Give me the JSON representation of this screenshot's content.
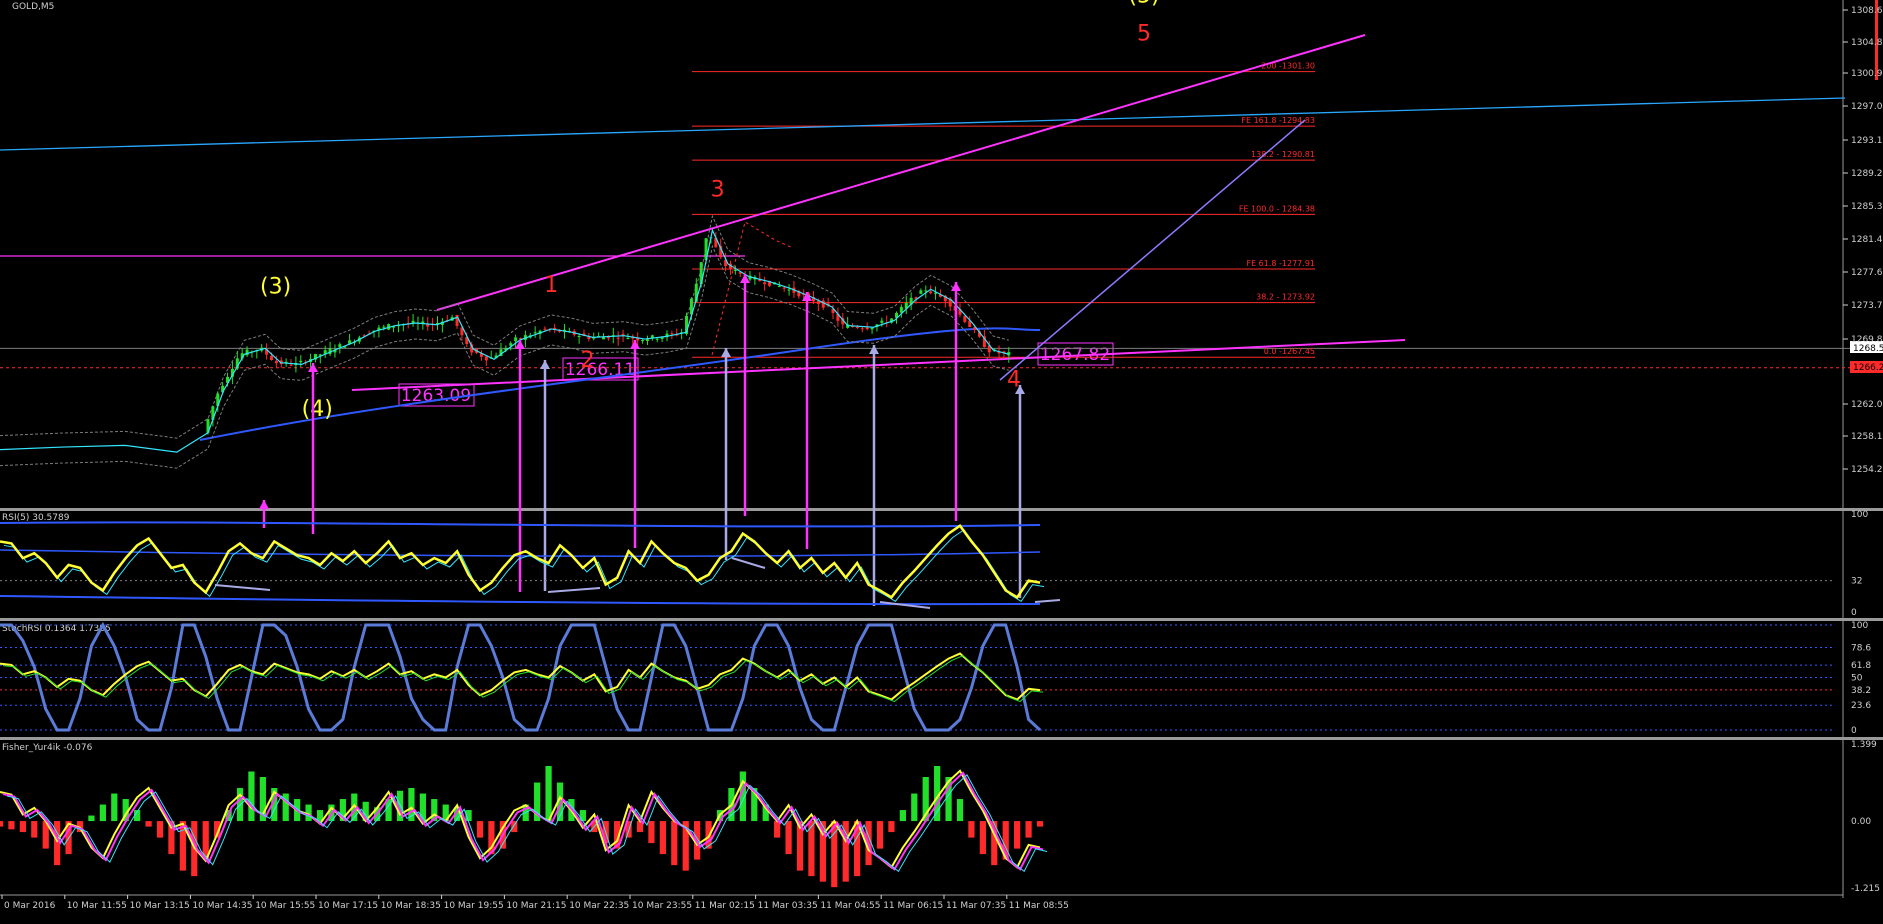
{
  "window": {
    "symbol_label": "GOLD,M5"
  },
  "colors": {
    "background": "#000000",
    "grid_text": "#cfcfcf",
    "separator": "#9a9a9a",
    "magenta": "#ff33ff",
    "red": "#ff2a2a",
    "yellow": "#ffff33",
    "blue": "#2f59ff",
    "light_blue": "#2aa8ff",
    "cyan": "#33e6ff",
    "lavender": "#a9a9e6",
    "purple": "#8c7bff",
    "green": "#22e02a",
    "gray": "#7d7d7d",
    "steel": "#5b7bd8"
  },
  "chart_data": [
    {
      "type": "candlestick",
      "name": "main",
      "ylim": [
        1254.2,
        1308.6
      ],
      "y_ticks": [
        "1308.6",
        "1304.8",
        "1300.9",
        "1297.0",
        "1293.1",
        "1289.2",
        "1285.3",
        "1281.4",
        "1277.6",
        "1273.7",
        "1269.8",
        "1262.0",
        "1258.1",
        "1254.2"
      ],
      "price_tags": [
        {
          "label": "1268.5",
          "value": 1268.5
        },
        {
          "label": "1266.2",
          "value": 1266.2
        }
      ],
      "x_ticks": [
        "0 Mar 2016",
        "10 Mar 11:55",
        "10 Mar 13:15",
        "10 Mar 14:35",
        "10 Mar 15:55",
        "10 Mar 17:15",
        "10 Mar 18:35",
        "10 Mar 19:55",
        "10 Mar 21:15",
        "10 Mar 22:35",
        "10 Mar 23:55",
        "11 Mar 02:15",
        "11 Mar 03:35",
        "11 Mar 04:55",
        "11 Mar 06:15",
        "11 Mar 07:35",
        "11 Mar 08:55"
      ],
      "close_path": [
        [
          0,
          1256.5
        ],
        [
          0.06,
          1256.8
        ],
        [
          0.12,
          1257.0
        ],
        [
          0.17,
          1256.2
        ],
        [
          0.2,
          1258.5
        ],
        [
          0.215,
          1263.5
        ],
        [
          0.235,
          1267.8
        ],
        [
          0.255,
          1268.5
        ],
        [
          0.27,
          1266.8
        ],
        [
          0.29,
          1266.6
        ],
        [
          0.32,
          1268.2
        ],
        [
          0.34,
          1269.2
        ],
        [
          0.36,
          1270.5
        ],
        [
          0.38,
          1271.2
        ],
        [
          0.4,
          1271.5
        ],
        [
          0.42,
          1271.3
        ],
        [
          0.44,
          1272.2
        ],
        [
          0.455,
          1268.4
        ],
        [
          0.475,
          1267.2
        ],
        [
          0.5,
          1269.5
        ],
        [
          0.53,
          1270.8
        ],
        [
          0.55,
          1270.4
        ],
        [
          0.57,
          1269.8
        ],
        [
          0.6,
          1270.0
        ],
        [
          0.62,
          1269.6
        ],
        [
          0.64,
          1269.9
        ],
        [
          0.66,
          1270.4
        ],
        [
          0.675,
          1276.5
        ],
        [
          0.685,
          1282.5
        ],
        [
          0.7,
          1278.5
        ],
        [
          0.72,
          1277.0
        ],
        [
          0.74,
          1276.4
        ],
        [
          0.76,
          1275.6
        ],
        [
          0.78,
          1274.6
        ],
        [
          0.8,
          1273.4
        ],
        [
          0.815,
          1271.2
        ],
        [
          0.84,
          1271.0
        ],
        [
          0.86,
          1271.8
        ],
        [
          0.88,
          1274.2
        ],
        [
          0.895,
          1275.5
        ],
        [
          0.915,
          1274.2
        ],
        [
          0.935,
          1271.5
        ],
        [
          0.955,
          1268.3
        ],
        [
          0.97,
          1267.8
        ]
      ],
      "levels": [
        {
          "label": "200 -1301.30",
          "value": 1301.3
        },
        {
          "label": "FE 161.8 -1294.83",
          "value": 1294.83
        },
        {
          "label": "138.2 - 1290.81",
          "value": 1290.81
        },
        {
          "label": "FE 100.0 - 1284.38",
          "value": 1284.38
        },
        {
          "label": "FE 61.8 -1277.91",
          "value": 1277.91
        },
        {
          "label": "38.2 - 1273.92",
          "value": 1273.92
        },
        {
          "label": "0.0 -1267.45",
          "value": 1267.45
        }
      ],
      "wave_labels": [
        {
          "text": "(5)",
          "color": "yellow",
          "x": 1.1,
          "y": 1309.5
        },
        {
          "text": "5",
          "color": "red",
          "x": 1.1,
          "y": 1305.0
        },
        {
          "text": "3",
          "color": "red",
          "x": 0.69,
          "y": 1286.5
        },
        {
          "text": "1",
          "color": "red",
          "x": 0.53,
          "y": 1275.2
        },
        {
          "text": "2",
          "color": "red",
          "x": 0.565,
          "y": 1266.3
        },
        {
          "text": "4",
          "color": "red",
          "x": 0.975,
          "y": 1264.0
        },
        {
          "text": "(3)",
          "color": "yellow",
          "x": 0.265,
          "y": 1275.0
        },
        {
          "text": "(4)",
          "color": "yellow",
          "x": 0.305,
          "y": 1260.5
        }
      ],
      "price_callouts": [
        "1263.09",
        "1266.11",
        "1267.82"
      ]
    },
    {
      "type": "line",
      "name": "rsi",
      "title": "RSI(5) 30.5789",
      "ylim": [
        0,
        100
      ],
      "y_ticks": [
        "100",
        "32",
        "0"
      ],
      "series": [
        {
          "values": [
            72,
            70,
            55,
            60,
            50,
            35,
            48,
            45,
            30,
            22,
            40,
            55,
            68,
            75,
            60,
            45,
            48,
            30,
            20,
            40,
            62,
            70,
            60,
            55,
            72,
            65,
            58,
            55,
            48,
            60,
            52,
            62,
            50,
            60,
            72,
            55,
            60,
            48,
            55,
            50,
            62,
            38,
            22,
            30,
            45,
            58,
            62,
            55,
            50,
            68,
            58,
            45,
            55,
            28,
            35,
            62,
            50,
            72,
            60,
            50,
            45,
            32,
            38,
            55,
            62,
            80,
            72,
            60,
            50,
            62,
            45,
            55,
            40,
            50,
            35,
            50,
            28,
            22,
            15,
            30,
            42,
            55,
            68,
            80,
            88,
            72,
            58,
            40,
            22,
            15,
            32,
            30
          ]
        }
      ]
    },
    {
      "type": "line",
      "name": "stochrsi",
      "title": "StochRSI 0.1364 1.7385",
      "ylim": [
        0,
        100
      ],
      "y_ticks": [
        "100",
        "78.6",
        "61.8",
        "50",
        "38.2",
        "23.6",
        "0"
      ],
      "series": [
        {
          "values": [
            100,
            100,
            85,
            60,
            20,
            0,
            0,
            30,
            80,
            100,
            80,
            50,
            10,
            0,
            0,
            40,
            100,
            100,
            70,
            30,
            0,
            0,
            50,
            100,
            100,
            90,
            60,
            20,
            0,
            0,
            10,
            60,
            100,
            100,
            100,
            70,
            30,
            10,
            0,
            0,
            60,
            100,
            100,
            80,
            50,
            10,
            0,
            0,
            30,
            80,
            100,
            100,
            100,
            60,
            20,
            0,
            0,
            50,
            100,
            100,
            80,
            40,
            0,
            0,
            0,
            30,
            80,
            100,
            100,
            80,
            40,
            10,
            0,
            0,
            40,
            80,
            100,
            100,
            100,
            60,
            20,
            0,
            0,
            0,
            10,
            40,
            80,
            100,
            100,
            60,
            10,
            0
          ]
        }
      ]
    },
    {
      "type": "bar",
      "name": "fisher",
      "title": "Fisher_Yur4ik -0.076",
      "ylim": [
        -1.215,
        1.399
      ],
      "y_ticks": [
        "1.399",
        "0.00",
        "-1.215"
      ],
      "values": [
        -0.1,
        -0.15,
        -0.2,
        -0.3,
        -0.5,
        -0.8,
        -0.6,
        -0.2,
        0.1,
        0.3,
        0.5,
        0.4,
        0.2,
        -0.1,
        -0.3,
        -0.6,
        -0.9,
        -1.0,
        -0.7,
        -0.3,
        0.2,
        0.6,
        0.9,
        0.8,
        0.6,
        0.5,
        0.4,
        0.3,
        0.2,
        0.3,
        0.4,
        0.5,
        0.35,
        0.25,
        0.4,
        0.55,
        0.6,
        0.5,
        0.4,
        0.3,
        0.25,
        0.2,
        -0.3,
        -0.6,
        -0.5,
        -0.2,
        0.3,
        0.7,
        1.0,
        0.7,
        0.4,
        0.2,
        -0.2,
        -0.4,
        -0.5,
        -0.3,
        -0.2,
        -0.4,
        -0.6,
        -0.8,
        -0.9,
        -0.7,
        -0.5,
        0.2,
        0.6,
        0.9,
        0.6,
        0.3,
        -0.3,
        -0.6,
        -0.9,
        -1.0,
        -1.1,
        -1.2,
        -1.1,
        -1.0,
        -0.8,
        -0.5,
        -0.2,
        0.2,
        0.5,
        0.8,
        1.0,
        0.8,
        0.4,
        -0.3,
        -0.6,
        -0.8,
        -0.7,
        -0.5,
        -0.3,
        -0.1
      ]
    }
  ]
}
